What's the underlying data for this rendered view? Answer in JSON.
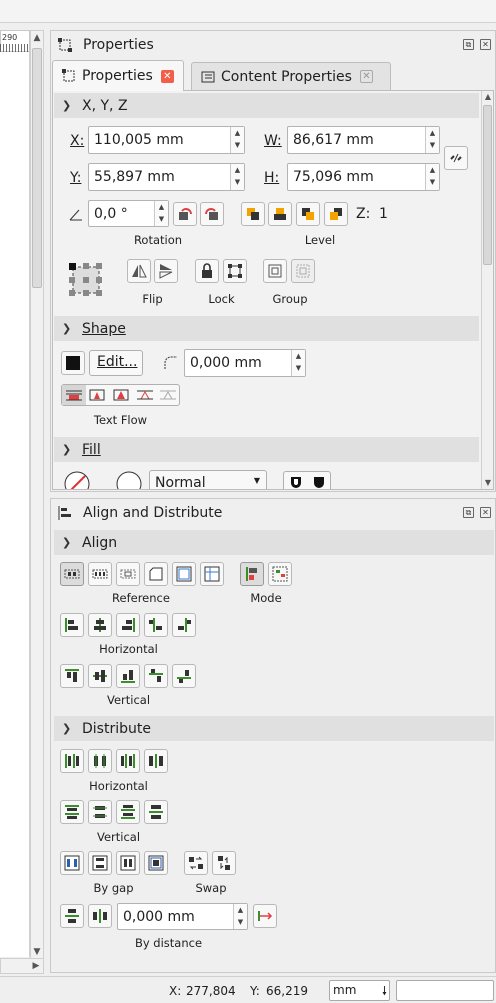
{
  "ruler": {
    "tick_label": "290"
  },
  "properties_panel": {
    "title": "Properties",
    "tabs": [
      {
        "label": "Properties",
        "active": true
      },
      {
        "label": "Content Properties",
        "active": false
      }
    ],
    "xyz": {
      "header": "X, Y, Z",
      "x_label": "X:",
      "x_value": "110,005 mm",
      "y_label": "Y:",
      "y_value": "55,897 mm",
      "w_label": "W:",
      "w_value": "86,617 mm",
      "h_label": "H:",
      "h_value": "75,096 mm",
      "rotation_value": "0,0 °",
      "rotation_label": "Rotation",
      "level_label": "Level",
      "z_label": "Z:",
      "z_value": "1",
      "flip_label": "Flip",
      "lock_label": "Lock",
      "group_label": "Group"
    },
    "shape": {
      "header": "Shape",
      "edit_label": "Edit...",
      "corner_radius": "0,000 mm",
      "text_flow_label": "Text Flow"
    },
    "fill": {
      "header": "Fill",
      "blend_mode": "Normal"
    }
  },
  "align_panel": {
    "title": "Align and Distribute",
    "align": {
      "header": "Align",
      "reference_label": "Reference",
      "mode_label": "Mode",
      "horizontal_label": "Horizontal",
      "vertical_label": "Vertical"
    },
    "distribute": {
      "header": "Distribute",
      "horizontal_label": "Horizontal",
      "vertical_label": "Vertical",
      "by_gap_label": "By gap",
      "swap_label": "Swap",
      "distance_value": "0,000 mm",
      "by_distance_label": "By distance"
    }
  },
  "status_bar": {
    "x_label": "X:",
    "x_value": "277,804",
    "y_label": "Y:",
    "y_value": "66,219",
    "unit": "mm"
  },
  "colors": {
    "close_tab_red": "#f15f48",
    "section_header": "#e0e0e0",
    "accent_green": "#3a8f2c"
  }
}
